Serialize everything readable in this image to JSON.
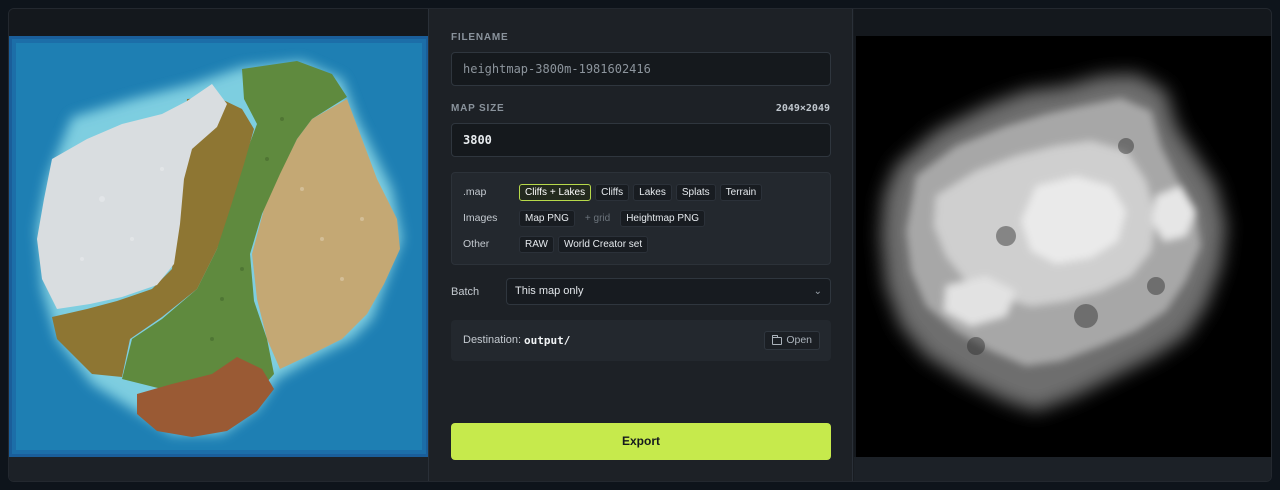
{
  "filename": {
    "label": "FILENAME",
    "value": "heightmap-3800m-1981602416"
  },
  "map_size": {
    "label": "MAP SIZE",
    "resolution": "2049×2049",
    "value": "3800"
  },
  "export_options": {
    "map_row": {
      "label": ".map",
      "chips": [
        "Cliffs + Lakes",
        "Cliffs",
        "Lakes",
        "Splats",
        "Terrain"
      ],
      "active": "Cliffs + Lakes"
    },
    "images_row": {
      "label": "Images",
      "chips": [
        "Map PNG",
        "+ grid",
        "Heightmap PNG"
      ]
    },
    "other_row": {
      "label": "Other",
      "chips": [
        "RAW",
        "World Creator set"
      ]
    }
  },
  "batch": {
    "label": "Batch",
    "selected": "This map only"
  },
  "destination": {
    "label": "Destination:",
    "value": "output/",
    "open_label": "Open"
  },
  "export_label": "Export",
  "colors": {
    "accent": "#c6ea4c",
    "water": "#1e7fb3",
    "snow": "#d9dde0",
    "forest": "#5f8a3e",
    "highland": "#c4a874",
    "olive": "#8e7633",
    "clay": "#9a5a34"
  },
  "icons": {
    "select": "chevron-down-icon",
    "open": "folder-icon"
  }
}
